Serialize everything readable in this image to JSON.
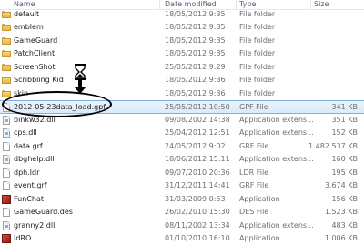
{
  "header": {
    "name": "Name",
    "date": "Date modified",
    "type": "Type",
    "size": "Size"
  },
  "rows": [
    {
      "name": "default",
      "date": "18/05/2012 9:35",
      "type": "File folder",
      "size": "",
      "icon": "folder-icon"
    },
    {
      "name": "emblem",
      "date": "18/05/2012 9:35",
      "type": "File folder",
      "size": "",
      "icon": "folder-icon"
    },
    {
      "name": "GameGuard",
      "date": "18/05/2012 9:35",
      "type": "File folder",
      "size": "",
      "icon": "folder-icon"
    },
    {
      "name": "PatchClient",
      "date": "18/05/2012 9:35",
      "type": "File folder",
      "size": "",
      "icon": "folder-icon"
    },
    {
      "name": "ScreenShot",
      "date": "25/05/2012 9:29",
      "type": "File folder",
      "size": "",
      "icon": "folder-icon"
    },
    {
      "name": "Scribbling Kid",
      "date": "18/05/2012 9:36",
      "type": "File folder",
      "size": "",
      "icon": "folder-icon"
    },
    {
      "name": "skin",
      "date": "18/05/2012 9:36",
      "type": "File folder",
      "size": "",
      "icon": "folder-icon"
    },
    {
      "name": "2012-05-23data_load.gpf",
      "date": "25/05/2012 10:50",
      "type": "GPF File",
      "size": "341 KB",
      "icon": "file-icon"
    },
    {
      "name": "binkw32.dll",
      "date": "09/08/2002 14:38",
      "type": "Application extens...",
      "size": "351 KB",
      "icon": "dll-icon"
    },
    {
      "name": "cps.dll",
      "date": "25/04/2012 12:51",
      "type": "Application extens...",
      "size": "152 KB",
      "icon": "dll-icon"
    },
    {
      "name": "data.grf",
      "date": "24/05/2012 9:02",
      "type": "GRF File",
      "size": "1.482.537 KB",
      "icon": "file-icon"
    },
    {
      "name": "dbghelp.dll",
      "date": "18/06/2012 15:11",
      "type": "Application extens...",
      "size": "160 KB",
      "icon": "dll-icon"
    },
    {
      "name": "dph.ldr",
      "date": "09/07/2010 20:36",
      "type": "LDR File",
      "size": "195 KB",
      "icon": "file-icon"
    },
    {
      "name": "event.grf",
      "date": "31/12/2011 14:41",
      "type": "GRF File",
      "size": "3.674 KB",
      "icon": "file-icon"
    },
    {
      "name": "FunChat",
      "date": "31/03/2009 0:53",
      "type": "Application",
      "size": "156 KB",
      "icon": "app-icon"
    },
    {
      "name": "GameGuard.des",
      "date": "26/02/2010 15:30",
      "type": "DES File",
      "size": "1.523 KB",
      "icon": "file-icon"
    },
    {
      "name": "granny2.dll",
      "date": "08/11/2002 13:34",
      "type": "Application extens...",
      "size": "483 KB",
      "icon": "dll-icon"
    },
    {
      "name": "IdRO",
      "date": "01/10/2010 16:10",
      "type": "Application",
      "size": "1.006 KB",
      "icon": "app-icon"
    }
  ],
  "selected_index": 7,
  "colors": {
    "selection": "#d9ebfb",
    "selection_border": "#84acdd",
    "header_text": "#4c607a"
  }
}
